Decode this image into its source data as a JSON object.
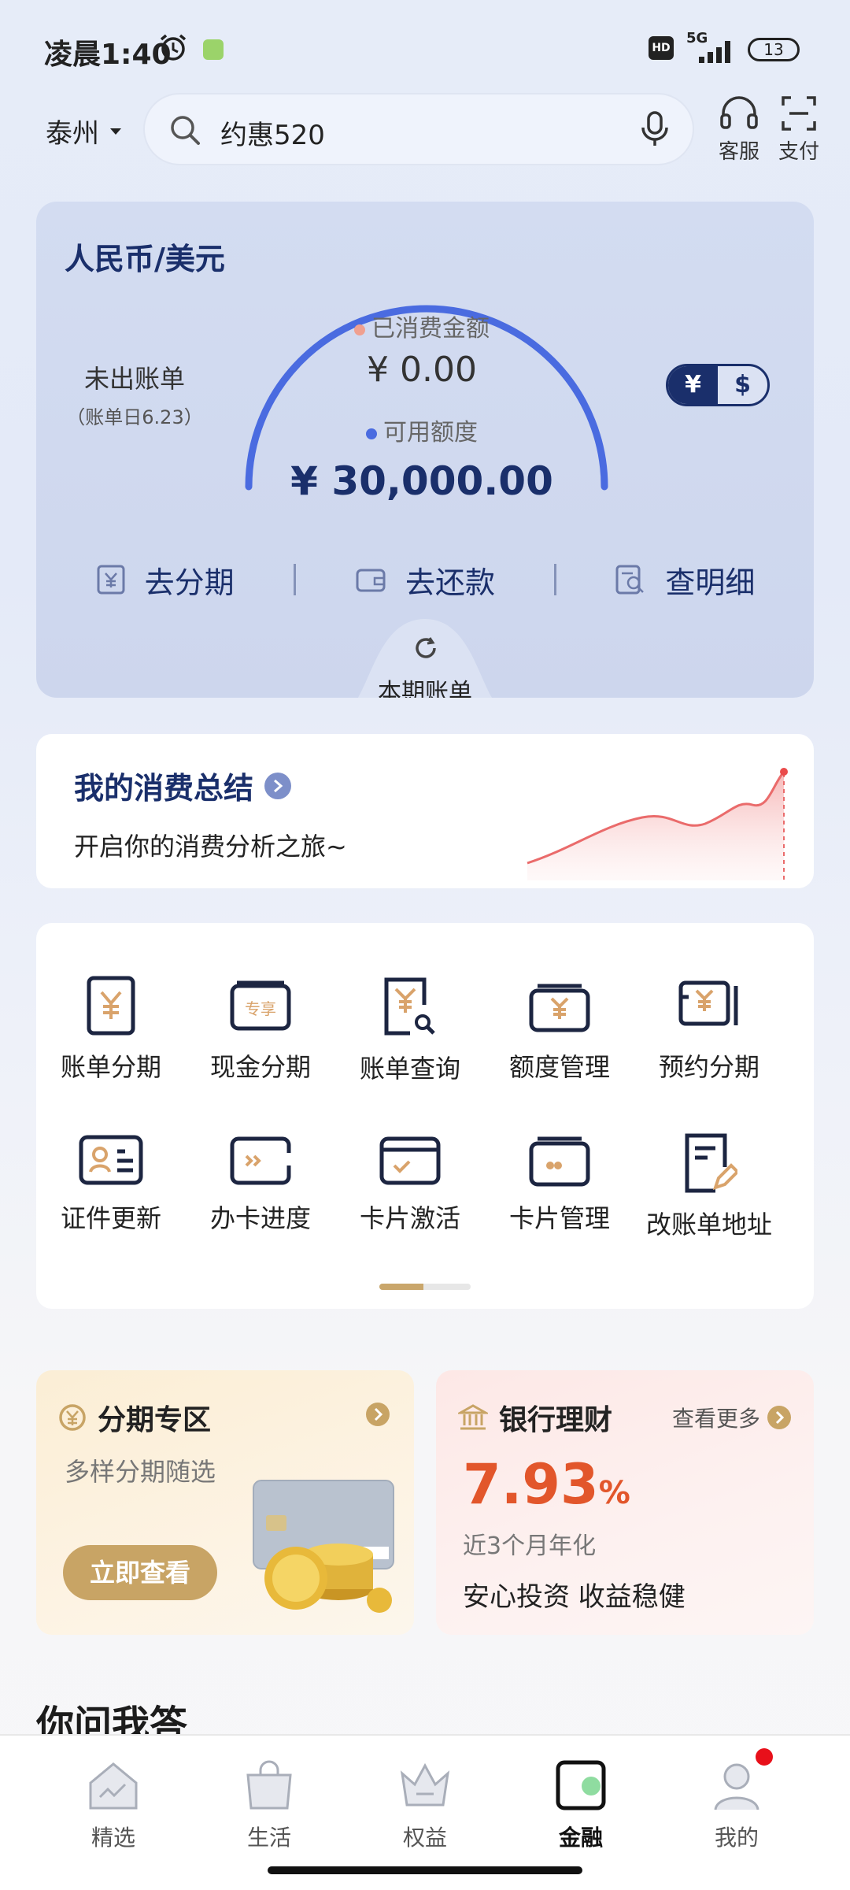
{
  "status_bar": {
    "time": "凌晨1:40",
    "hd": "HD",
    "net": "5G",
    "battery": "13"
  },
  "header": {
    "city": "泰州",
    "search_text": "约惠520",
    "service_label": "客服",
    "pay_label": "支付"
  },
  "card": {
    "title": "人民币/美元",
    "unbilled_label": "未出账单",
    "bill_date": "（账单日6.23）",
    "spent_label": "已消费金额",
    "spent_value": "¥ 0.00",
    "available_label": "可用额度",
    "available_value": "¥ 30,000.00",
    "currency_cny": "¥",
    "currency_usd": "$",
    "actions": [
      "去分期",
      "去还款",
      "查明细"
    ],
    "bill_tab": "本期账单",
    "colors": {
      "accent": "#1a2f6b",
      "arc": "#4a6be0",
      "spent_dot": "#f0a090",
      "avail_dot": "#4a6be0"
    }
  },
  "summary": {
    "title": "我的消费总结",
    "subtitle": "开启你的消费分析之旅~"
  },
  "grid": {
    "row1": [
      "账单分期",
      "现金分期",
      "账单查询",
      "额度管理",
      "预约分期"
    ],
    "row2": [
      "证件更新",
      "办卡进度",
      "卡片激活",
      "卡片管理",
      "改账单地址"
    ],
    "badge": "专享",
    "icons": [
      "yen-doc-icon",
      "cash-card-icon",
      "bill-search-icon",
      "wallet-icon",
      "reserve-card-icon",
      "id-card-icon",
      "card-progress-icon",
      "card-activate-icon",
      "card-manage-icon",
      "edit-address-icon"
    ]
  },
  "promo_installment": {
    "title": "分期专区",
    "subtitle": "多样分期随选",
    "button": "立即查看"
  },
  "promo_wealth": {
    "title": "银行理财",
    "more": "查看更多",
    "rate": "7.93",
    "rate_unit": "%",
    "rate_desc": "近3个月年化",
    "tagline": "安心投资 收益稳健",
    "rate_color": "#e2562b"
  },
  "qa_title": "你问我答",
  "tabbar": {
    "items": [
      "精选",
      "生活",
      "权益",
      "金融",
      "我的"
    ],
    "active": "金融"
  }
}
